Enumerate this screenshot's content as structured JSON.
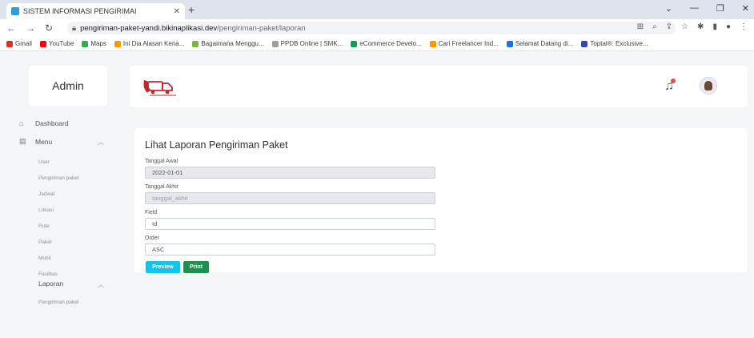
{
  "browser": {
    "tab_title": "SISTEM INFORMASI PENGIRIMAI",
    "url_domain": "pengiriman-paket-yandi.bikinaplikasi.dev",
    "url_path": "/pengiriman-paket/laporan",
    "bookmarks": [
      {
        "label": "Gmail",
        "color": "#d93025"
      },
      {
        "label": "YouTube",
        "color": "#ff0000"
      },
      {
        "label": "Maps",
        "color": "#34a853"
      },
      {
        "label": "Ini Dia Alasan Kena...",
        "color": "#f29900"
      },
      {
        "label": "Bagaimana Menggu...",
        "color": "#7cb342"
      },
      {
        "label": "PPDB Online | SMK...",
        "color": "#9e9e9e"
      },
      {
        "label": "eCommerce Develo...",
        "color": "#0f9d58"
      },
      {
        "label": "Cari Freelancer Ind...",
        "color": "#ff9800"
      },
      {
        "label": "Selamat Datang di...",
        "color": "#1a73e8"
      },
      {
        "label": "Toptal®: Exclusive...",
        "color": "#3949ab"
      }
    ]
  },
  "sidebar": {
    "brand": "Admin",
    "dashboard": "Dashboard",
    "menu": "Menu",
    "menu_items": [
      "User",
      "Pengiriman paket",
      "Jadwal",
      "Lokasi",
      "Rute",
      "Paket",
      "Mobil",
      "Fasilitas"
    ],
    "laporan": "Laporan",
    "laporan_items": [
      "Pengiriman paket"
    ]
  },
  "form": {
    "title": "Lihat Laporan Pengiriman Paket",
    "tanggal_awal_label": "Tanggal Awal",
    "tanggal_awal_value": "2022-01-01",
    "tanggal_akhir_label": "Tanggal Akhir",
    "tanggal_akhir_placeholder": "tanggal_akhir",
    "field_label": "Field",
    "field_value": "Id",
    "order_label": "Order",
    "order_value": "ASC",
    "preview_label": "Preview",
    "print_label": "Print"
  },
  "colors": {
    "preview_button": "#14c3e8",
    "print_button": "#1f8f4d",
    "notification_dot": "#e24b4b"
  }
}
